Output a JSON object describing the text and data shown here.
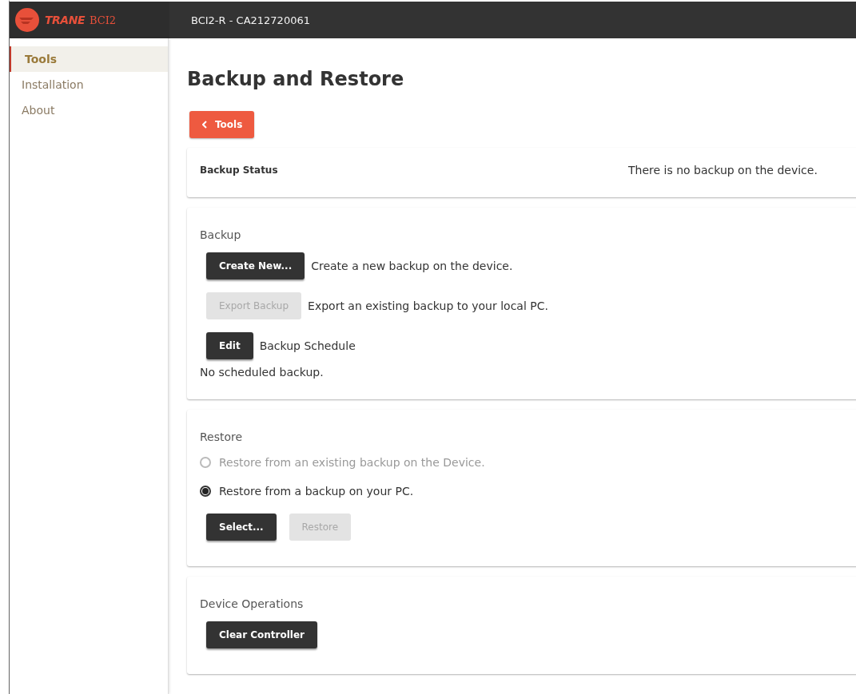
{
  "header": {
    "brand": "TRANE",
    "product": "BCI2",
    "device": "BCI2-R - CA212720061"
  },
  "sidebar": {
    "items": [
      {
        "label": "Tools",
        "selected": true
      },
      {
        "label": "Installation",
        "selected": false
      },
      {
        "label": "About",
        "selected": false
      }
    ]
  },
  "page": {
    "title": "Backup and Restore",
    "back_button": "Tools"
  },
  "status_card": {
    "label": "Backup Status",
    "message": "There is no backup on the device."
  },
  "backup_card": {
    "heading": "Backup",
    "actions": [
      {
        "button": "Create New...",
        "disabled": false,
        "description": "Create a new backup on the device."
      },
      {
        "button": "Export Backup",
        "disabled": true,
        "description": "Export an existing backup to your local PC."
      },
      {
        "button": "Edit",
        "disabled": false,
        "description": "Backup Schedule"
      }
    ],
    "schedule_note": "No scheduled backup."
  },
  "restore_card": {
    "heading": "Restore",
    "options": [
      {
        "label": "Restore from an existing backup on the Device.",
        "selected": false,
        "disabled": true
      },
      {
        "label": "Restore from a backup on your PC.",
        "selected": true,
        "disabled": false
      }
    ],
    "buttons": [
      {
        "label": "Select...",
        "disabled": false
      },
      {
        "label": "Restore",
        "disabled": true
      }
    ]
  },
  "device_card": {
    "heading": "Device Operations",
    "buttons": [
      {
        "label": "Clear Controller",
        "disabled": false
      }
    ]
  }
}
